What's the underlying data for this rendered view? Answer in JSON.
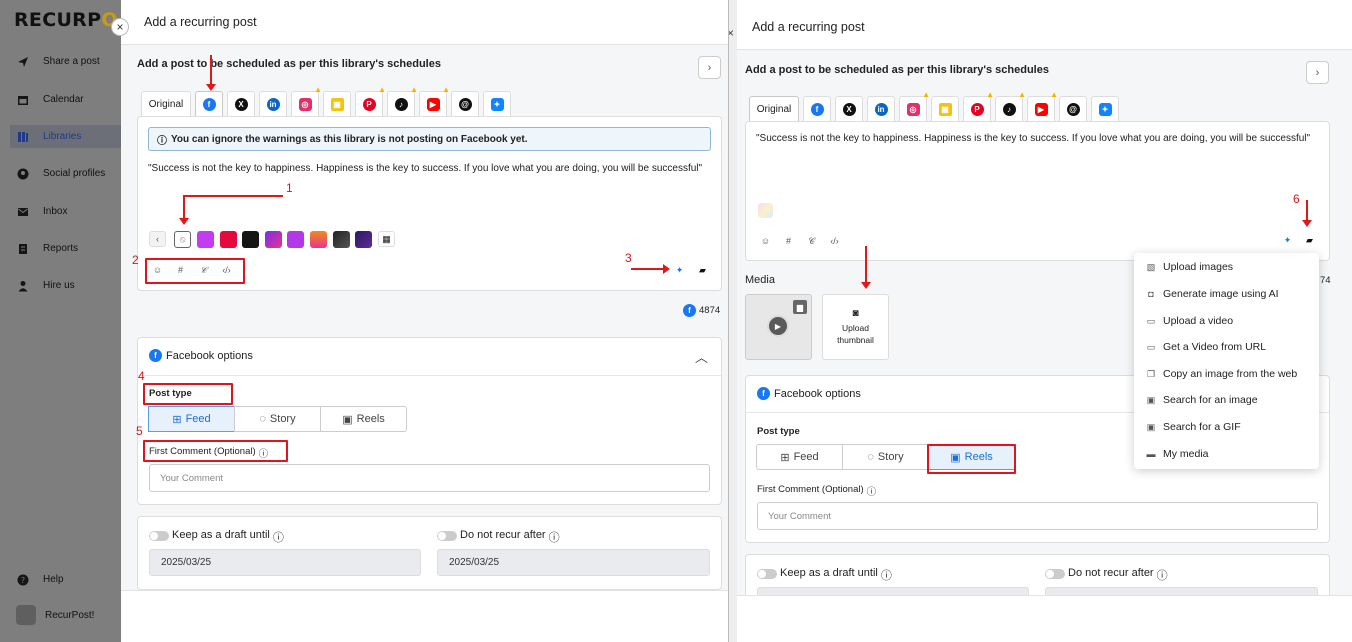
{
  "sidebar": {
    "logo": "RECURP",
    "logo_tail": "O",
    "items": [
      {
        "label": "Share a post",
        "icon": "send-icon"
      },
      {
        "label": "Calendar",
        "icon": "calendar-icon"
      },
      {
        "label": "Libraries",
        "icon": "libraries-icon"
      },
      {
        "label": "Social profiles",
        "icon": "user-circle-icon"
      },
      {
        "label": "Inbox",
        "icon": "inbox-icon"
      },
      {
        "label": "Reports",
        "icon": "reports-icon"
      },
      {
        "label": "Hire us",
        "icon": "person-icon"
      }
    ],
    "help": "Help",
    "account": "RecurPost!"
  },
  "dialog": {
    "title": "Add a recurring post",
    "subtitle": "Add a post to be scheduled as per this library's schedules",
    "tab_original": "Original"
  },
  "left": {
    "notice": "You can ignore the warnings as this library is not posting on Facebook yet.",
    "quote": "\"Success is not the key to happiness. Happiness is the key to success. If you love what you are doing, you will be successful\"",
    "char_count": "4874",
    "options_title": "Facebook options",
    "post_type_label": "Post type",
    "post_types": [
      "Feed",
      "Story",
      "Reels"
    ],
    "first_comment_label": "First Comment (Optional)",
    "comment_placeholder": "Your Comment",
    "draft_label": "Keep as a draft until",
    "norecur_label": "Do not recur after",
    "draft_date": "2025/03/25",
    "norecur_date": "2025/03/25"
  },
  "annotations": [
    "1",
    "2",
    "3",
    "4",
    "5",
    "6"
  ],
  "right": {
    "quote": "\"Success is not the key to happiness. Happiness is the key to success. If you love what you are doing, you will be successful\"",
    "media_label": "Media",
    "upload_thumb": "Upload thumbnail",
    "count_partial": "74",
    "options_title": "Facebook options",
    "post_type_label": "Post type",
    "post_types": [
      "Feed",
      "Story",
      "Reels"
    ],
    "first_comment_label": "First Comment (Optional)",
    "comment_placeholder": "Your Comment",
    "draft_label": "Keep as a draft until",
    "norecur_label": "Do not recur after"
  },
  "media_menu": [
    "Upload images",
    "Generate image using AI",
    "Upload a video",
    "Get a Video from URL",
    "Copy an image from the web",
    "Search for an image",
    "Search for a GIF",
    "My media"
  ],
  "colors": {
    "accent": "#1877f2",
    "annotation": "#e0141e",
    "sidebar": "#7e7e7e"
  }
}
